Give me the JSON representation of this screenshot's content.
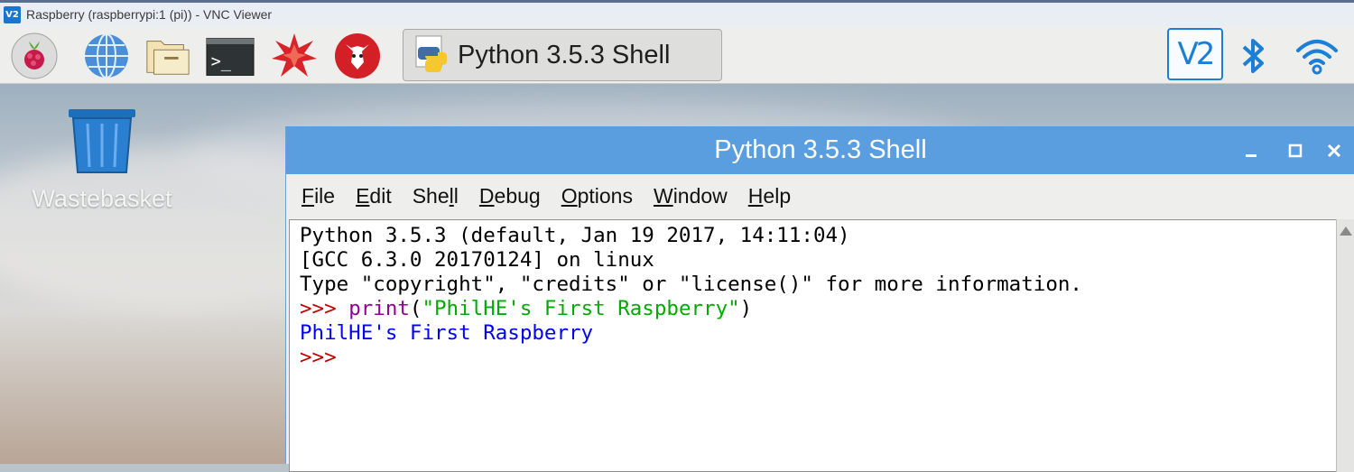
{
  "vnc": {
    "logo": "V2",
    "title": "Raspberry (raspberrypi:1 (pi)) - VNC Viewer"
  },
  "taskbar": {
    "launchers": [
      {
        "icon": "raspberry-menu-icon"
      },
      {
        "icon": "web-browser-icon"
      },
      {
        "icon": "file-manager-icon"
      },
      {
        "icon": "terminal-icon"
      },
      {
        "icon": "mathematica-icon"
      },
      {
        "icon": "wolfram-icon"
      }
    ],
    "task_button_label": "Python 3.5.3 Shell",
    "tray": {
      "vnc_label": "V2",
      "icons": [
        "vnc-icon",
        "bluetooth-icon",
        "wifi-icon"
      ]
    }
  },
  "desktop": {
    "wastebasket_label": "Wastebasket"
  },
  "idle": {
    "title": "Python 3.5.3 Shell",
    "menus": [
      {
        "first": "F",
        "rest": "ile"
      },
      {
        "first": "E",
        "rest": "dit"
      },
      {
        "first": "",
        "pre": "She",
        "u": "l",
        "post": "l"
      },
      {
        "first": "D",
        "rest": "ebug"
      },
      {
        "first": "O",
        "rest": "ptions"
      },
      {
        "first": "W",
        "rest": "indow"
      },
      {
        "first": "H",
        "rest": "elp"
      }
    ],
    "shell": {
      "banner1": "Python 3.5.3 (default, Jan 19 2017, 14:11:04)",
      "banner2": "[GCC 6.3.0 20170124] on linux",
      "banner3": "Type \"copyright\", \"credits\" or \"license()\" for more information.",
      "prompt": ">>> ",
      "cmd_func": "print",
      "cmd_open": "(",
      "cmd_string": "\"PhilHE's First Raspberry\"",
      "cmd_close": ")",
      "output": "PhilHE's First Raspberry",
      "prompt2": ">>>"
    }
  }
}
